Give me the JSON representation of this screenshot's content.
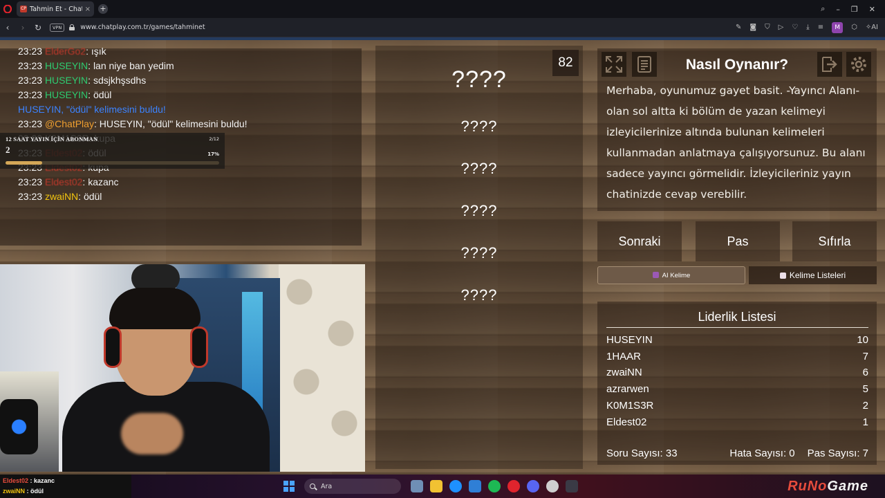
{
  "browser": {
    "tab_title": "Tahmin Et - ChatPlay",
    "tab_favicon": "CP",
    "vpn_label": "VPN",
    "url": "www.chatplay.com.tr/games/tahminet",
    "profile_initial": "M",
    "ai_label": "AI"
  },
  "chat": {
    "lines": [
      {
        "time": "23:23",
        "user": "ElderGo2",
        "text": ": ışık"
      },
      {
        "time": "23:23",
        "user": "HUSEYIN",
        "text": ": lan niye ban yedim"
      },
      {
        "time": "23:23",
        "user": "HUSEYIN",
        "text": ": sdsjkhşsdhs"
      },
      {
        "time": "23:23",
        "user": "HUSEYIN",
        "text": ": ödül"
      },
      {
        "time": "",
        "user": "",
        "text": "HUSEYIN, \"ödül\" kelimesini buldu!"
      },
      {
        "time": "23:23",
        "user": "@ChatPlay",
        "text": ": HUSEYIN, \"ödül\" kelimesini buldu!"
      },
      {
        "time": "23:23",
        "user": "K0M1S3R",
        "text": ": kupa"
      },
      {
        "time": "23:23",
        "user": "Eldest02",
        "text": ": ödül"
      },
      {
        "time": "23:23",
        "user": "Eldest02",
        "text": ": kupa"
      },
      {
        "time": "23:23",
        "user": "Eldest02",
        "text": ": kazanc"
      },
      {
        "time": "23:23",
        "user": "zwaiNN",
        "text": ": ödül"
      }
    ]
  },
  "sub_goal": {
    "label": "12 SAAT YAYIN İÇİN ABONMAN",
    "count": "2/12",
    "current": "2",
    "percent_text": "17%",
    "progress": 0.17
  },
  "game": {
    "counter": "82",
    "words": [
      "????",
      "????",
      "????",
      "????",
      "????",
      "????"
    ]
  },
  "howto": {
    "title": "Nasıl Oynanır?",
    "text": "Merhaba, oyunumuz gayet basit. -Yayıncı Alanı- olan sol altta ki bölüm de yazan kelimeyi izleyicilerinize altında bulunan kelimeleri kullanmadan anlatmaya çalışıyorsunuz. Bu alanı sadece yayıncı görmelidir. İzleyicileriniz yayın chatinizde cevap verebilir."
  },
  "actions": {
    "next": "Sonraki",
    "pass": "Pas",
    "reset": "Sıfırla",
    "ai_word": "AI Kelime",
    "word_lists": "Kelime Listeleri"
  },
  "leaderboard": {
    "title": "Liderlik Listesi",
    "rows": [
      {
        "name": "HUSEYIN",
        "score": "10"
      },
      {
        "name": "1HAAR",
        "score": "7"
      },
      {
        "name": "zwaiNN",
        "score": "6"
      },
      {
        "name": "azrarwen",
        "score": "5"
      },
      {
        "name": "K0M1S3R",
        "score": "2"
      },
      {
        "name": "Eldest02",
        "score": "1"
      }
    ],
    "questions": "Soru Sayısı: 33",
    "errors": "Hata Sayısı: 0",
    "passes": "Pas Sayısı: 7"
  },
  "stream_chat": [
    {
      "user": "Eldest02",
      "text": " : kazanc"
    },
    {
      "user": "zwaiNN",
      "text": " : ödül"
    }
  ],
  "taskbar": {
    "search_placeholder": "Ara"
  },
  "watermark": {
    "brand_a": "RuNo",
    "brand_b": "Game"
  },
  "colors": {
    "wood": "#6d5741",
    "panel": "#2d2118",
    "chat_green": "#2ecc71",
    "chat_blue": "#3c83ff",
    "chat_red": "#c0392b"
  }
}
